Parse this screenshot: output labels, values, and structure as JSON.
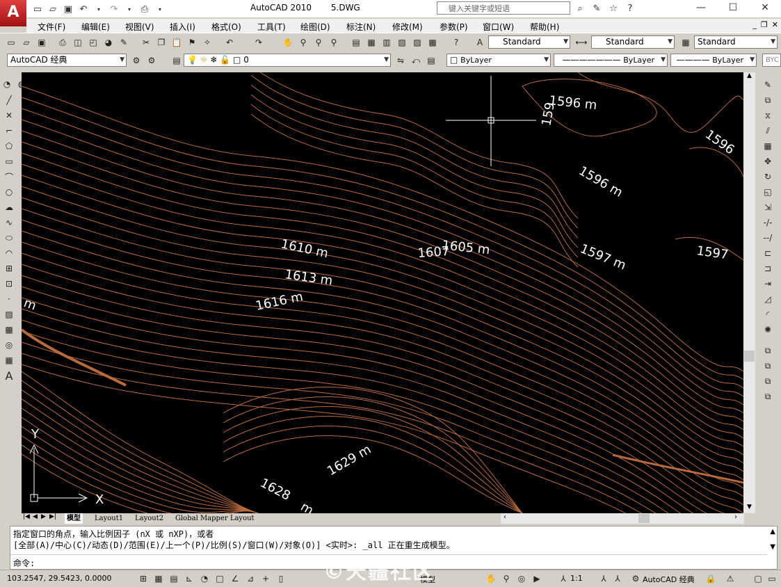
{
  "app": {
    "logo_letter": "A",
    "title": "AutoCAD 2010",
    "document": "5.DWG"
  },
  "search": {
    "placeholder": "键入关键字或短语"
  },
  "window_controls": {
    "minimize": "—",
    "maximize": "☐",
    "close": "✕"
  },
  "menu": [
    "文件(F)",
    "编辑(E)",
    "视图(V)",
    "插入(I)",
    "格式(O)",
    "工具(T)",
    "绘图(D)",
    "标注(N)",
    "修改(M)",
    "参数(P)",
    "窗口(W)",
    "帮助(H)"
  ],
  "styles": {
    "text_style": "Standard",
    "dim_style": "Standard",
    "table_style": "Standard"
  },
  "workspace": "AutoCAD 经典",
  "layer": "0",
  "properties": {
    "color": "ByLayer",
    "linetype": "ByLayer",
    "lineweight": "ByLayer",
    "plotstyle": "BYC"
  },
  "drawing": {
    "background": "#000000",
    "contour_color": "#b86a3c",
    "crosshair_color": "#ffffff",
    "labels": [
      {
        "text": "1596 m",
        "id": "1596-top"
      },
      {
        "text": "1596",
        "id": "1596-right"
      },
      {
        "text": "1596 m",
        "id": "1596-mid"
      },
      {
        "text": "1597 m",
        "id": "1597-a"
      },
      {
        "text": "1597",
        "id": "1597-b"
      },
      {
        "text": "1610 m",
        "id": "1610"
      },
      {
        "text": "1607",
        "id": "1607"
      },
      {
        "text": "1605 m",
        "id": "1605"
      },
      {
        "text": "1613 m",
        "id": "1613"
      },
      {
        "text": "1616 m",
        "id": "1616"
      },
      {
        "text": "1629 m",
        "id": "1629"
      },
      {
        "text": "1628",
        "id": "1628"
      },
      {
        "text": "m",
        "id": "m-left"
      },
      {
        "text": "m",
        "id": "m-bottom"
      },
      {
        "text": "159",
        "id": "159-vert"
      }
    ],
    "ucs": {
      "x_label": "X",
      "y_label": "Y"
    }
  },
  "layout_tabs": [
    "模型",
    "Layout1",
    "Layout2",
    "Global Mapper Layout"
  ],
  "command": {
    "line1": "指定窗口的角点，输入比例因子 (nX 或 nXP)，或者",
    "line2": "[全部(A)/中心(C)/动态(D)/范围(E)/上一个(P)/比例(S)/窗口(W)/对象(O)] <实时>: _all 正在重生成模型。",
    "prompt": "命令:"
  },
  "status": {
    "coordinates": "103.2547, 29.5423, 0.0000",
    "model_label": "模型",
    "scale": "1:1",
    "workspace": "AutoCAD 经典"
  },
  "watermark": "©天疆社区"
}
